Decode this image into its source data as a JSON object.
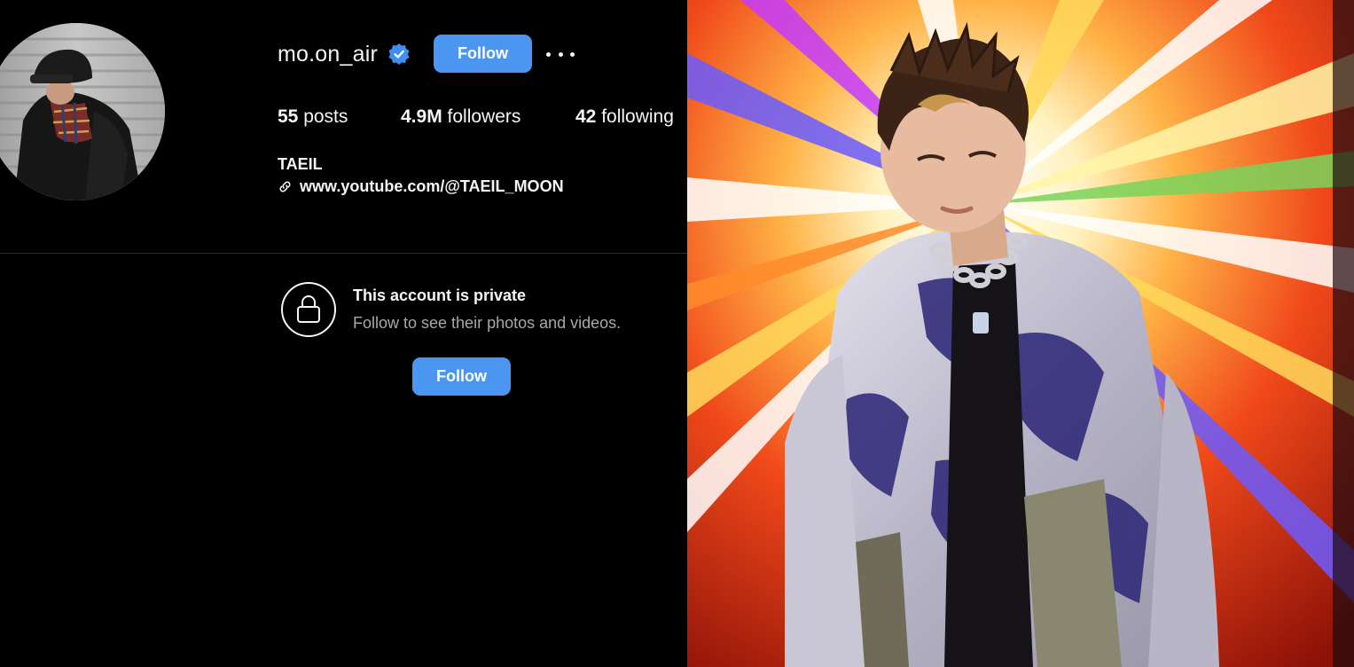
{
  "profile": {
    "username": "mo.on_air",
    "verified_icon": "verified-badge-icon",
    "follow_label": "Follow",
    "more_icon": "more-options-icon",
    "stats": {
      "posts_count": "55",
      "posts_label": "posts",
      "followers_count": "4.9M",
      "followers_label": "followers",
      "following_count": "42",
      "following_label": "following"
    },
    "full_name": "TAEIL",
    "link_icon": "link-icon",
    "link_text": "www.youtube.com/@TAEIL_MOON"
  },
  "private_notice": {
    "icon": "lock-icon",
    "title": "This account is private",
    "subtitle": "Follow to see their photos and videos.",
    "follow_label": "Follow"
  },
  "colors": {
    "background": "#000000",
    "primary_button": "#4a96f0",
    "verified": "#3f8ef0",
    "secondary_text": "#a8a8a8"
  }
}
